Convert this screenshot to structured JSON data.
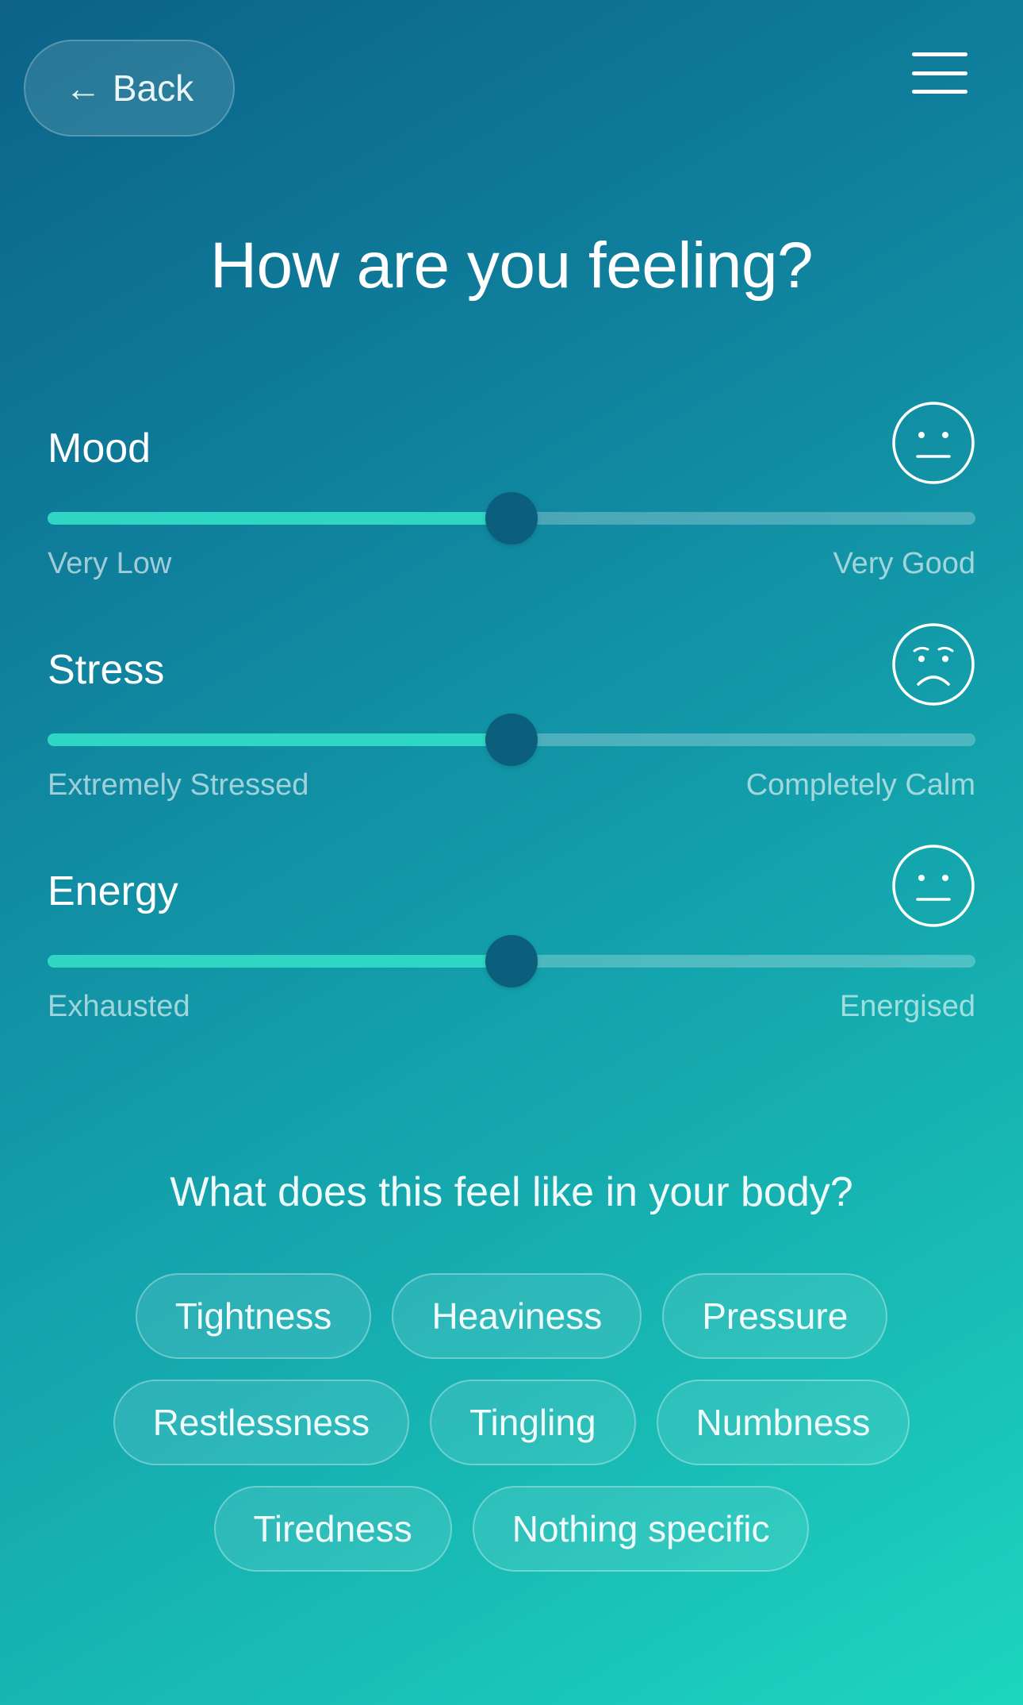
{
  "header": {
    "back_icon": "←",
    "back_label": "Back",
    "menu_icon": "hamburger-menu-icon"
  },
  "title": "How are you feeling?",
  "sliders": [
    {
      "label": "Mood",
      "min_label": "Very Low",
      "max_label": "Very Good",
      "value_fraction": 0.5,
      "face": "neutral-face-icon"
    },
    {
      "label": "Stress",
      "min_label": "Extremely Stressed",
      "max_label": "Completely Calm",
      "value_fraction": 0.5,
      "face": "worried-face-icon"
    },
    {
      "label": "Energy",
      "min_label": "Exhausted",
      "max_label": "Energised",
      "value_fraction": 0.5,
      "face": "neutral-face-icon"
    }
  ],
  "body_question": "What does this feel like in your body?",
  "chips": [
    "Tightness",
    "Heaviness",
    "Pressure",
    "Restlessness",
    "Tingling",
    "Numbness",
    "Tiredness",
    "Nothing specific"
  ],
  "colors": {
    "track_fill": "#2fd6c3",
    "thumb": "#0b5f7c",
    "gradient_start": "#0c6288",
    "gradient_end": "#1dd6bf"
  }
}
